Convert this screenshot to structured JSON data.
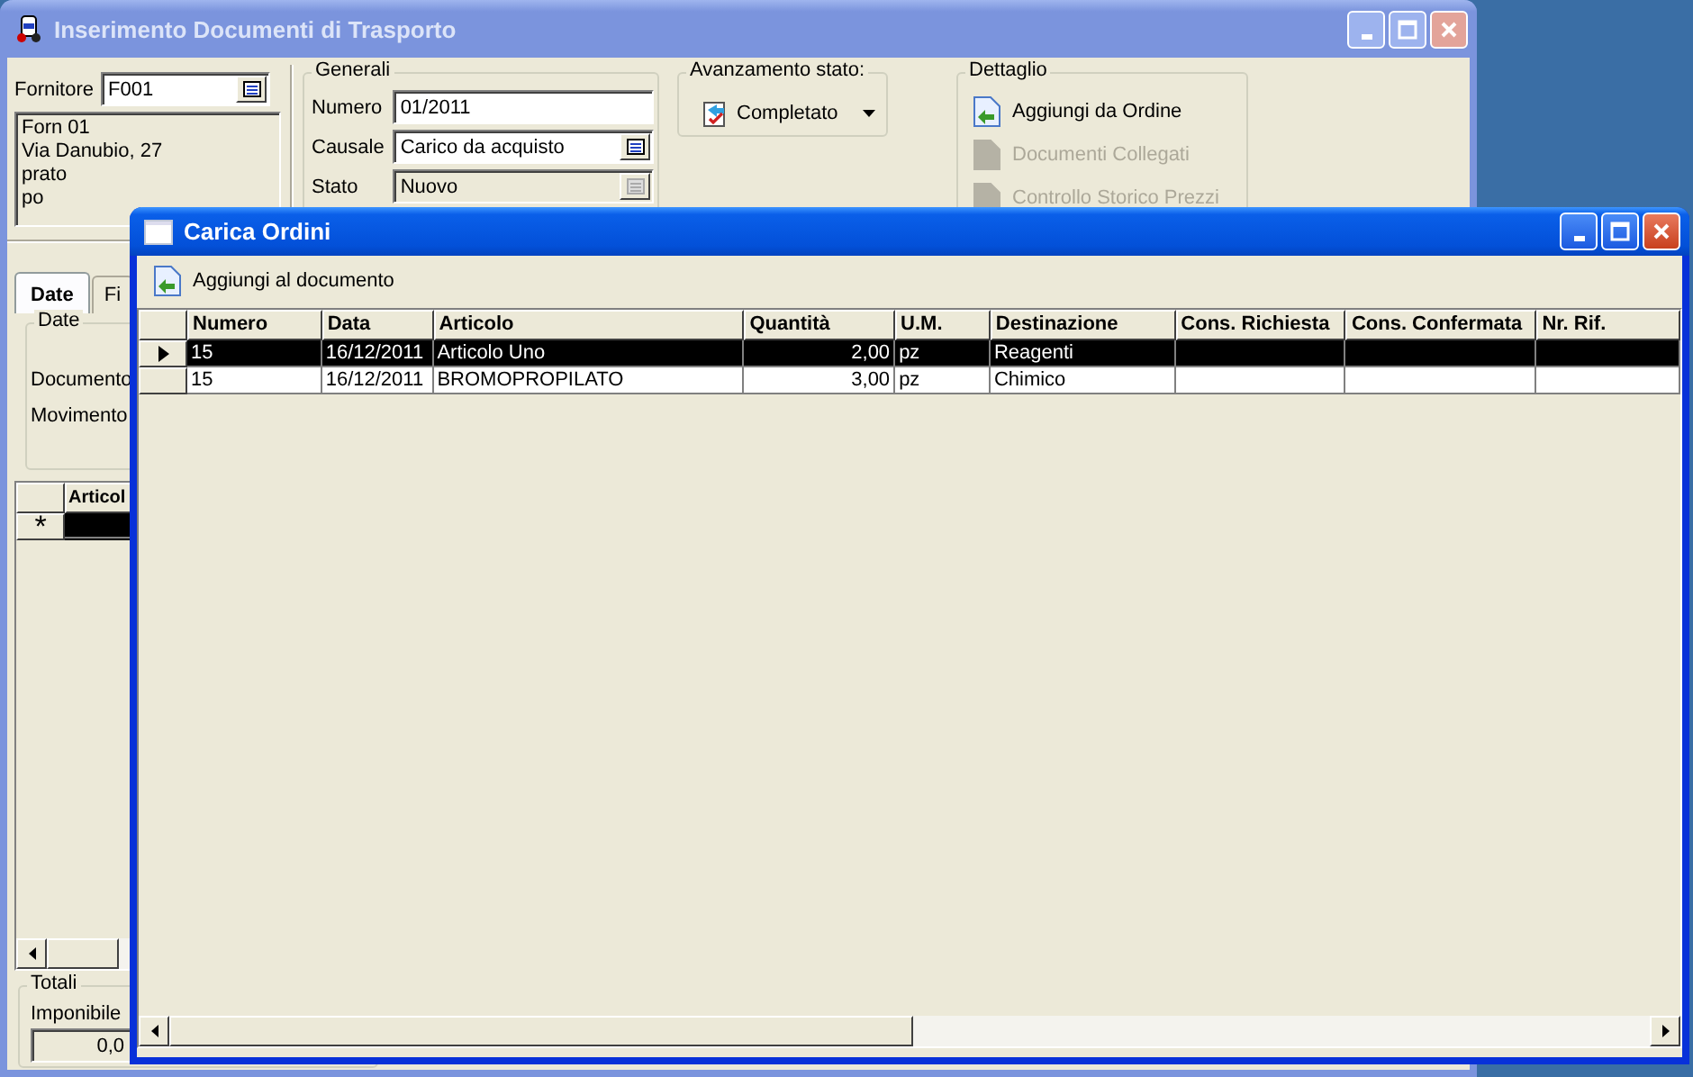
{
  "main_window": {
    "title": "Inserimento Documenti di Trasporto",
    "active": false,
    "supplier": {
      "label": "Fornitore",
      "value": "F001",
      "address": [
        "Forn 01",
        "Via Danubio, 27",
        "prato",
        "po"
      ]
    },
    "generali": {
      "title": "Generali",
      "fields": [
        {
          "label": "Numero",
          "value": "01/2011",
          "kind": "text",
          "disabled": false
        },
        {
          "label": "Causale",
          "value": "Carico da acquisto",
          "kind": "lookup",
          "disabled": false
        },
        {
          "label": "Stato",
          "value": "Nuovo",
          "kind": "lookup",
          "disabled": true
        }
      ]
    },
    "status_progress": {
      "title": "Avanzamento stato:",
      "value": "Completato"
    },
    "dettaglio": {
      "title": "Dettaglio",
      "actions": [
        {
          "label": "Aggiungi da Ordine",
          "disabled": false
        },
        {
          "label": "Documenti Collegati",
          "disabled": true
        },
        {
          "label": "Controllo Storico Prezzi",
          "disabled": true
        }
      ]
    },
    "tabs": [
      {
        "label": "Date",
        "selected": true
      },
      {
        "label": "Fi",
        "selected": false
      }
    ],
    "date_group": {
      "title": "Date",
      "fields": [
        "Documento",
        "Movimento"
      ]
    },
    "grid": {
      "columns": [
        "Articol"
      ],
      "new_row_marker": "*"
    },
    "totals": {
      "title": "Totali",
      "label": "Imponibile",
      "value": "0,0"
    }
  },
  "dialog": {
    "title": "Carica Ordini",
    "active": true,
    "toolbar": [
      {
        "label": "Aggiungi al documento"
      }
    ],
    "table": {
      "columns": [
        {
          "label": "Numero"
        },
        {
          "label": "Data"
        },
        {
          "label": "Articolo"
        },
        {
          "label": "Quantità"
        },
        {
          "label": "U.M."
        },
        {
          "label": "Destinazione"
        },
        {
          "label": "Cons. Richiesta"
        },
        {
          "label": "Cons. Confermata"
        },
        {
          "label": "Nr. Rif."
        }
      ],
      "rows": [
        {
          "selected": true,
          "cells": [
            "15",
            "16/12/2011",
            "Articolo Uno",
            "2,00",
            "pz",
            "Reagenti"
          ]
        },
        {
          "selected": false,
          "cells": [
            "15",
            "16/12/2011",
            "BROMOPROPILATO",
            "3,00",
            "pz",
            "Chimico"
          ]
        }
      ]
    }
  }
}
